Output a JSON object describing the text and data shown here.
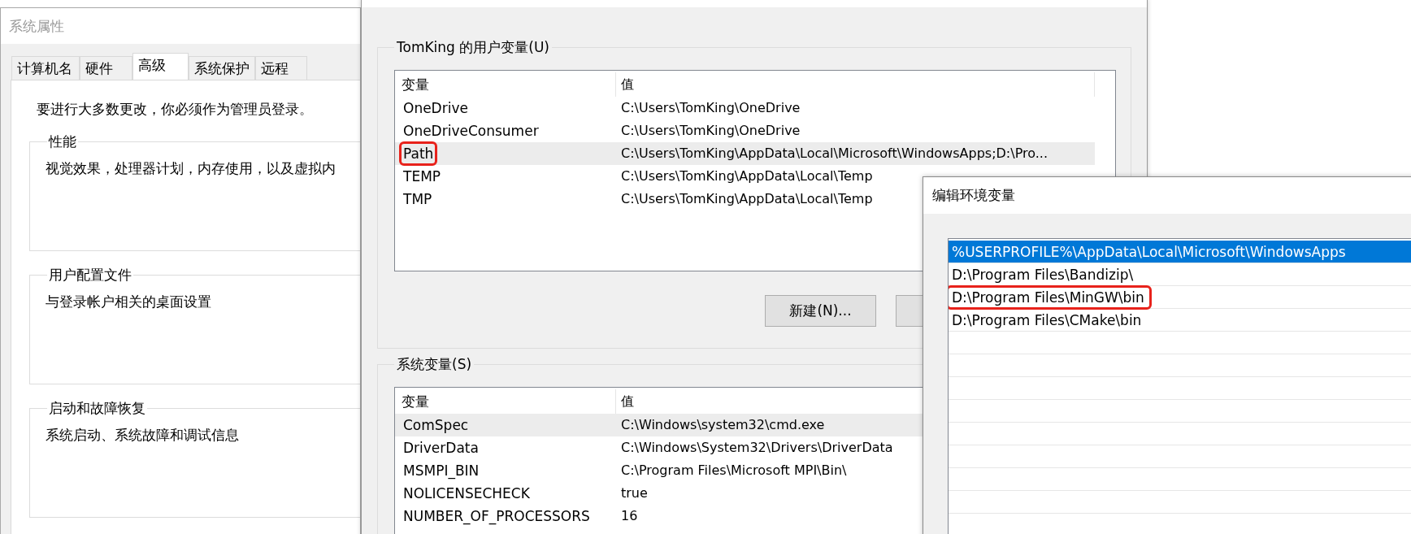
{
  "system_properties": {
    "title": "系统属性",
    "tabs": [
      {
        "label": "计算机名",
        "selected": false
      },
      {
        "label": "硬件",
        "selected": false
      },
      {
        "label": "高级",
        "selected": true
      },
      {
        "label": "系统保护",
        "selected": false
      },
      {
        "label": "远程",
        "selected": false
      }
    ],
    "notice": "要进行大多数更改，你必须作为管理员登录。",
    "groups": [
      {
        "title": "性能",
        "description": "视觉效果，处理器计划，内存使用，以及虚拟内"
      },
      {
        "title": "用户配置文件",
        "description": "与登录帐户相关的桌面设置"
      },
      {
        "title": "启动和故障恢复",
        "description": "系统启动、系统故障和调试信息"
      }
    ]
  },
  "environment_variables": {
    "sections": [
      {
        "title": "TomKing 的用户变量(U)",
        "columns": [
          "变量",
          "值"
        ],
        "rows": [
          {
            "name": "OneDrive",
            "value": "C:\\Users\\TomKing\\OneDrive",
            "selected": false,
            "marked": false
          },
          {
            "name": "OneDriveConsumer",
            "value": "C:\\Users\\TomKing\\OneDrive",
            "selected": false,
            "marked": false
          },
          {
            "name": "Path",
            "value": "C:\\Users\\TomKing\\AppData\\Local\\Microsoft\\WindowsApps;D:\\Pro...",
            "selected": true,
            "marked": true
          },
          {
            "name": "TEMP",
            "value": "C:\\Users\\TomKing\\AppData\\Local\\Temp",
            "selected": false,
            "marked": false
          },
          {
            "name": "TMP",
            "value": "C:\\Users\\TomKing\\AppData\\Local\\Temp",
            "selected": false,
            "marked": false
          }
        ],
        "buttons": [
          "新建(N)..."
        ]
      },
      {
        "title": "系统变量(S)",
        "columns": [
          "变量",
          "值"
        ],
        "rows": [
          {
            "name": "ComSpec",
            "value": "C:\\Windows\\system32\\cmd.exe",
            "selected": true,
            "marked": false
          },
          {
            "name": "DriverData",
            "value": "C:\\Windows\\System32\\Drivers\\DriverData",
            "selected": false,
            "marked": false
          },
          {
            "name": "MSMPI_BIN",
            "value": "C:\\Program Files\\Microsoft MPI\\Bin\\",
            "selected": false,
            "marked": false
          },
          {
            "name": "NOLICENSECHECK",
            "value": "true",
            "selected": false,
            "marked": false
          },
          {
            "name": "NUMBER_OF_PROCESSORS",
            "value": "16",
            "selected": false,
            "marked": false
          }
        ]
      }
    ]
  },
  "edit_dialog": {
    "title": "编辑环境变量",
    "entries": [
      {
        "text": "%USERPROFILE%\\AppData\\Local\\Microsoft\\WindowsApps",
        "selected": true,
        "marked": false
      },
      {
        "text": "D:\\Program Files\\Bandizip\\",
        "selected": false,
        "marked": false
      },
      {
        "text": "D:\\Program Files\\MinGW\\bin",
        "selected": false,
        "marked": true
      },
      {
        "text": "D:\\Program Files\\CMake\\bin",
        "selected": false,
        "marked": false
      }
    ]
  }
}
